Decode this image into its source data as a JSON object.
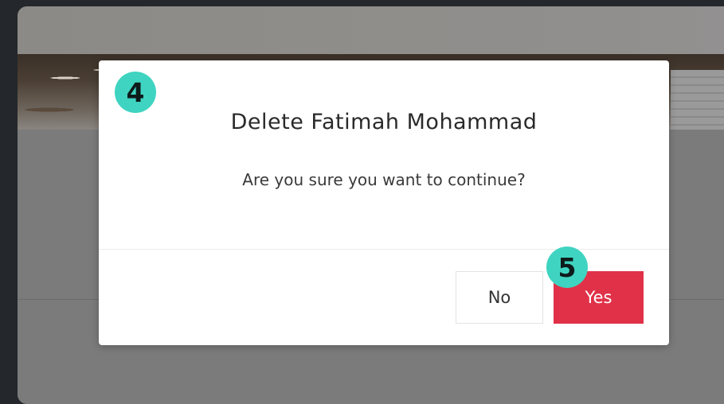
{
  "dialog": {
    "title": "Delete Fatimah Mohammad",
    "message": "Are you sure you want to continue?",
    "buttons": {
      "no_label": "No",
      "yes_label": "Yes"
    }
  },
  "annotations": {
    "step_4": "4",
    "step_5": "5"
  },
  "colors": {
    "danger": "#e03148",
    "badge": "#3fd4c1",
    "overlay": "#7b7b7b"
  }
}
